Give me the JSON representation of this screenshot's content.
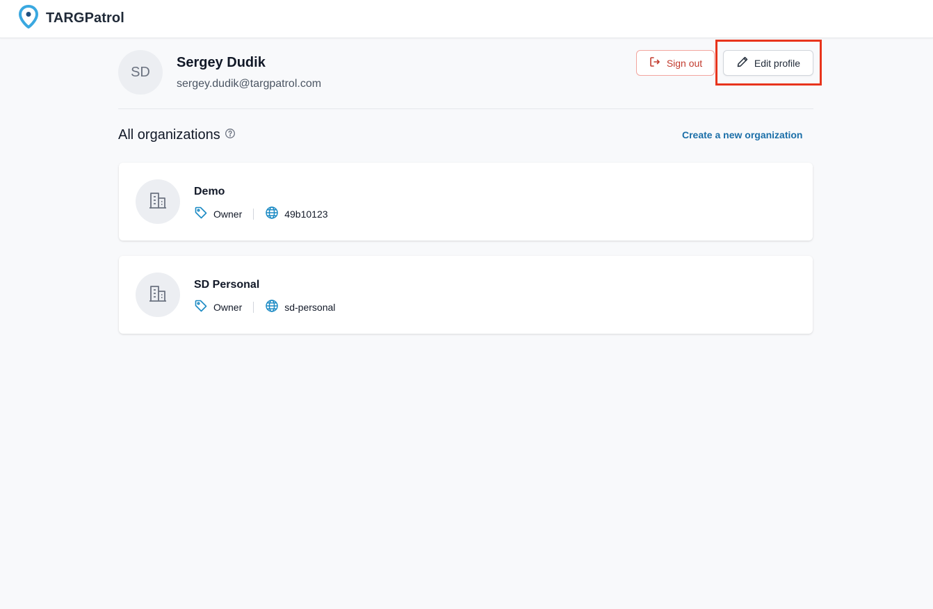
{
  "app": {
    "name": "TARGPatrol"
  },
  "profile": {
    "initials": "SD",
    "name": "Sergey Dudik",
    "email": "sergey.dudik@targpatrol.com"
  },
  "actions": {
    "sign_out_label": "Sign out",
    "edit_profile_label": "Edit profile"
  },
  "organizations": {
    "title": "All organizations",
    "create_label": "Create a new organization",
    "items": [
      {
        "name": "Demo",
        "role": "Owner",
        "slug": "49b10123"
      },
      {
        "name": "SD Personal",
        "role": "Owner",
        "slug": "sd-personal"
      }
    ]
  },
  "colors": {
    "accent": "#1b6fa8",
    "logo_blue": "#3aa8e0",
    "danger": "#c23b2e",
    "highlight": "#e8341c"
  },
  "icons": [
    "map-pin-logo-icon",
    "sign-out-icon",
    "pencil-icon",
    "help-circle-icon",
    "building-icon",
    "tag-icon",
    "globe-icon"
  ]
}
